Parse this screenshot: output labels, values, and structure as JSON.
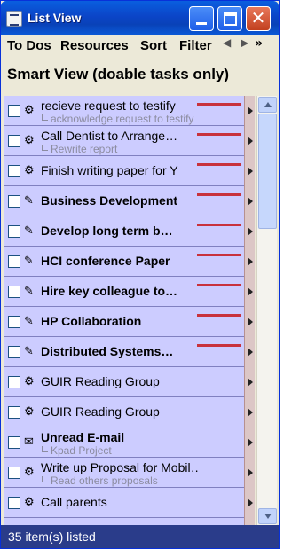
{
  "window": {
    "title": "List View",
    "controls": {
      "minimize": "minimize",
      "maximize": "maximize",
      "close": "✕"
    }
  },
  "menu": {
    "items": [
      "To Dos",
      "Resources",
      "Sort",
      "Filter"
    ],
    "arrow_left": "◀",
    "arrow_right": "▶",
    "more": "»"
  },
  "view_title": "Smart View (doable tasks only)",
  "colors": {
    "row_background": "#ccccff",
    "priority_bar": "#c8323c",
    "status_bar": "#2a3c8a"
  },
  "tasks": [
    {
      "label": "recieve request to testify",
      "sub": "acknowledge request to testify",
      "bold": false,
      "icon": "person-walking-icon",
      "priority": true
    },
    {
      "label": "Call Dentist to Arrange…",
      "sub": "Rewrite report",
      "bold": false,
      "icon": "person-walking-icon",
      "priority": true
    },
    {
      "label": "Finish writing paper for Y",
      "sub": "",
      "bold": false,
      "icon": "person-walking-icon",
      "priority": true
    },
    {
      "label": "Business Development",
      "sub": "",
      "bold": true,
      "icon": "project-icon",
      "priority": true
    },
    {
      "label": "Develop long term b…",
      "sub": "",
      "bold": true,
      "icon": "project-icon",
      "priority": true
    },
    {
      "label": "HCI conference Paper",
      "sub": "",
      "bold": true,
      "icon": "project-icon",
      "priority": true
    },
    {
      "label": "Hire key colleague to…",
      "sub": "",
      "bold": true,
      "icon": "project-icon",
      "priority": true
    },
    {
      "label": "HP Collaboration",
      "sub": "",
      "bold": true,
      "icon": "project-icon",
      "priority": true
    },
    {
      "label": "Distributed Systems…",
      "sub": "",
      "bold": true,
      "icon": "project-icon",
      "priority": true
    },
    {
      "label": "GUIR Reading Group",
      "sub": "",
      "bold": false,
      "icon": "person-walking-icon",
      "priority": false
    },
    {
      "label": "GUIR Reading Group",
      "sub": "",
      "bold": false,
      "icon": "person-walking-icon",
      "priority": false
    },
    {
      "label": "Unread E-mail",
      "sub": "Kpad Project",
      "bold": true,
      "icon": "envelope-icon",
      "priority": false
    },
    {
      "label": "Write up Proposal for Mobil…",
      "sub": "Read others proposals",
      "bold": false,
      "icon": "person-walking-icon",
      "priority": false
    },
    {
      "label": "Call parents",
      "sub": "",
      "bold": false,
      "icon": "person-walking-icon",
      "priority": false
    },
    {
      "label": "",
      "sub": "",
      "bold": false,
      "icon": "person-walking-icon",
      "priority": false
    }
  ],
  "status": "35 item(s) listed"
}
